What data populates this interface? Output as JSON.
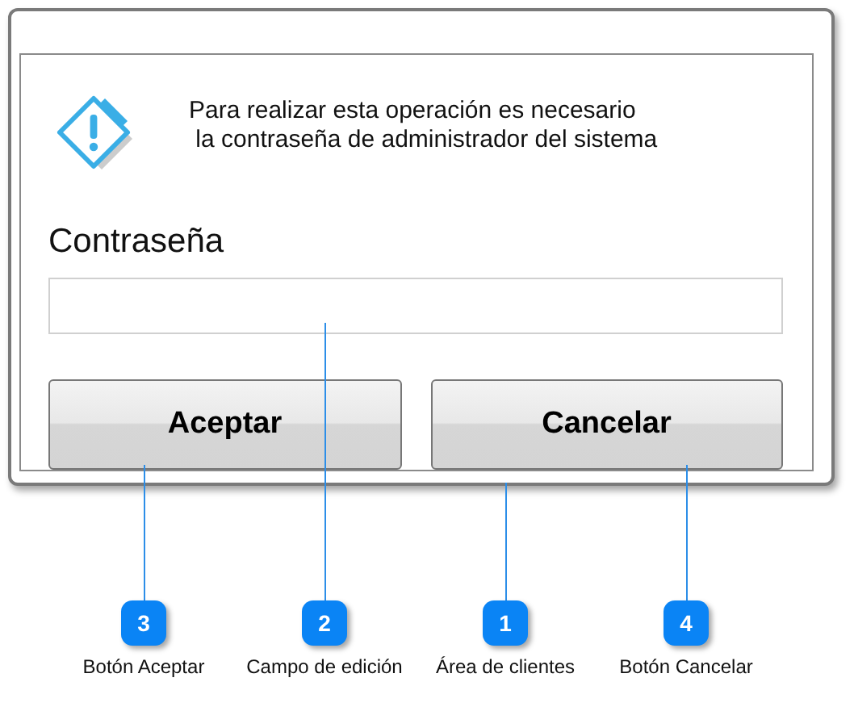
{
  "dialog": {
    "message_lines": [
      "Para realizar esta operación es necesario",
      "la contraseña de administrador del sistema"
    ],
    "password_label": "Contraseña",
    "buttons": [
      "Aceptar",
      "Cancelar"
    ]
  },
  "callouts": [
    {
      "number": "3",
      "label": "Botón Aceptar"
    },
    {
      "number": "2",
      "label": "Campo de edición"
    },
    {
      "number": "1",
      "label": "Área de clientes"
    },
    {
      "number": "4",
      "label": "Botón Cancelar"
    }
  ]
}
